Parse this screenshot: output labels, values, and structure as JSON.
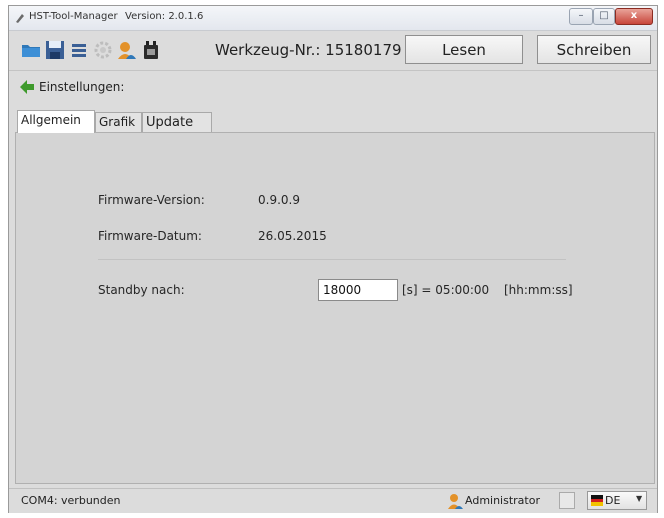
{
  "window": {
    "title": "HST-Tool-Manager",
    "version": "Version: 2.0.1.6",
    "controls": {
      "minimize": "–",
      "maximize": "□",
      "close": "x"
    }
  },
  "toolbar": {
    "icons": [
      "folder-open-icon",
      "save-icon",
      "list-icon",
      "gear-icon",
      "user-icon",
      "battery-icon"
    ],
    "tool_number": "Werkzeug-Nr.: 15180179",
    "read_label": "Lesen",
    "write_label": "Schreiben"
  },
  "settings": {
    "label": "Einstellungen:"
  },
  "tabs": [
    {
      "label": "Allgemein",
      "active": true
    },
    {
      "label": "Grafik",
      "active": false
    },
    {
      "label": "Update",
      "active": false
    }
  ],
  "general": {
    "firmware_version_label": "Firmware-Version:",
    "firmware_version_value": "0.9.0.9",
    "firmware_date_label": "Firmware-Datum:",
    "firmware_date_value": "26.05.2015",
    "standby_label": "Standby nach:",
    "standby_value": "18000",
    "standby_result": "[s] = 05:00:00",
    "standby_format": "[hh:mm:ss]"
  },
  "statusbar": {
    "connection": "COM4: verbunden",
    "user": "Administrator",
    "language": "DE"
  },
  "colors": {
    "background": "#dcdcdc",
    "content": "#d4d4d4",
    "folder_blue": "#2f78b8",
    "arrow_green": "#3e9a2c",
    "user_orange": "#e3922a"
  }
}
